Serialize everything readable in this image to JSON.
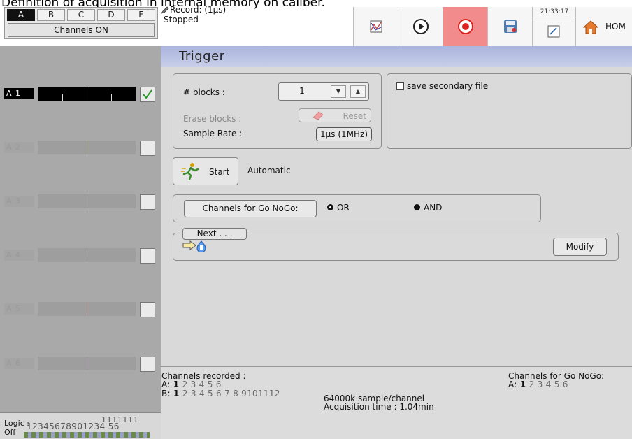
{
  "caption": "Definition of acquisition in internal memory on caliber.",
  "group_tabs": [
    {
      "label": "A",
      "active": true
    },
    {
      "label": "B",
      "active": false
    },
    {
      "label": "C",
      "active": false
    },
    {
      "label": "D",
      "active": false
    },
    {
      "label": "E",
      "active": false
    }
  ],
  "channels_on_label": "Channels ON",
  "record": {
    "line1": "Record: (1µs)",
    "line2": "Stopped"
  },
  "toolbar": {
    "buttons": [
      {
        "name": "chart-icon"
      },
      {
        "name": "play-icon"
      },
      {
        "name": "record-icon",
        "color": "#f28b8b"
      },
      {
        "name": "save-disk-icon"
      }
    ],
    "clock_time": "21:33:17",
    "home_label": "HOM"
  },
  "channels": [
    {
      "label": "A 1",
      "enabled": true,
      "checked": true
    },
    {
      "label": "A 2",
      "enabled": false,
      "checked": false
    },
    {
      "label": "A 3",
      "enabled": false,
      "checked": false
    },
    {
      "label": "A 4",
      "enabled": false,
      "checked": false
    },
    {
      "label": "A 5",
      "enabled": false,
      "checked": false
    },
    {
      "label": "A 6",
      "enabled": false,
      "checked": false
    }
  ],
  "logic": {
    "label": "Logic :",
    "state": "Off",
    "tens": "1111111",
    "units": "12345678901234 56"
  },
  "page_title": "Trigger",
  "blocks": {
    "label": "# blocks :",
    "value": "1"
  },
  "erase": {
    "label": "Erase blocks :",
    "button": "Reset"
  },
  "sample_rate": {
    "label": "Sample Rate :",
    "value": "1µs (1MHz)"
  },
  "save_secondary": {
    "label": "save secondary file",
    "checked": false
  },
  "start": {
    "button": "Start",
    "mode": "Automatic"
  },
  "gonogo": {
    "button": "Channels for Go NoGo:",
    "or_label": "OR",
    "and_label": "AND",
    "selected": "AND"
  },
  "next": {
    "label": "Next . . .",
    "modify": "Modify"
  },
  "footer": {
    "recorded_title": "Channels recorded :",
    "rowA_prefix": "A:",
    "rowA_bold": "1",
    "rowA_rest": "2 3 4 5 6",
    "rowB_prefix": "B:",
    "rowB_bold": "1",
    "rowB_rest": "2 3 4 5 6 7 8 9101112",
    "samples": "64000k sample/channel",
    "acquisition": "Acquisition time : 1.04min",
    "gonogo_title": "Channels for Go NoGo:",
    "gonogoA_prefix": "A:",
    "gonogoA_bold": "1",
    "gonogoA_rest": "2 3 4 5 6"
  }
}
